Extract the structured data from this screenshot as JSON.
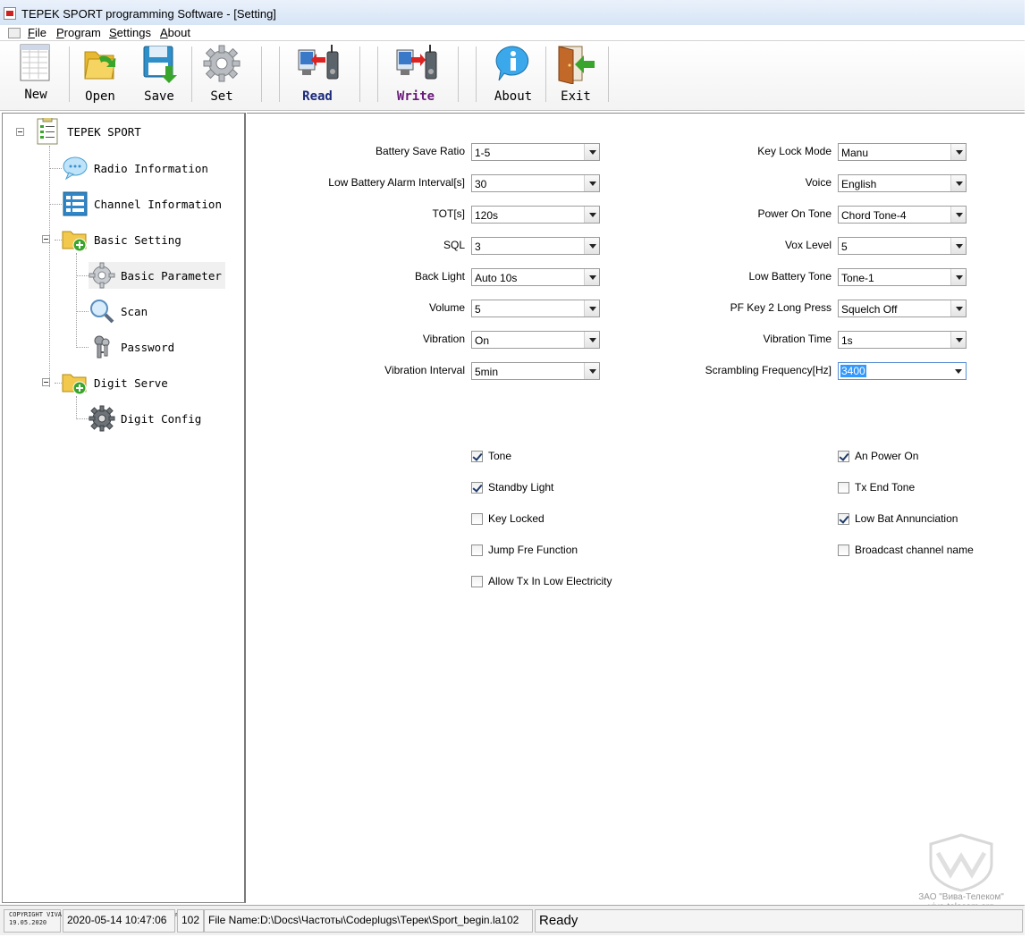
{
  "window": {
    "title": "TEPEK SPORT programming Software - [Setting]"
  },
  "menu": [
    {
      "label": "File",
      "accel": "F"
    },
    {
      "label": "Program",
      "accel": "P"
    },
    {
      "label": "Settings",
      "accel": "S"
    },
    {
      "label": "About",
      "accel": "A"
    }
  ],
  "toolbar": {
    "new": "New",
    "open": "Open",
    "save": "Save",
    "set": "Set",
    "read": "Read",
    "write": "Write",
    "about": "About",
    "exit": "Exit"
  },
  "tree": {
    "root": "TEPEK SPORT",
    "radio_info": "Radio Information",
    "channel_info": "Channel Information",
    "basic_setting": "Basic Setting",
    "basic_parameter": "Basic Parameter",
    "scan": "Scan",
    "password": "Password",
    "digit_serve": "Digit Serve",
    "digit_config": "Digit Config"
  },
  "fields_left": [
    {
      "label": "Battery Save Ratio",
      "value": "1-5"
    },
    {
      "label": "Low Battery Alarm Interval[s]",
      "value": "30"
    },
    {
      "label": "TOT[s]",
      "value": "120s"
    },
    {
      "label": "SQL",
      "value": "3"
    },
    {
      "label": "Back Light",
      "value": "Auto 10s"
    },
    {
      "label": "Volume",
      "value": "5"
    },
    {
      "label": "Vibration",
      "value": "On"
    },
    {
      "label": "Vibration Interval",
      "value": "5min"
    }
  ],
  "fields_right": [
    {
      "label": "Key Lock Mode",
      "value": "Manu"
    },
    {
      "label": "Voice",
      "value": "English"
    },
    {
      "label": "Power On Tone",
      "value": "Chord Tone-4"
    },
    {
      "label": "Vox Level",
      "value": "5"
    },
    {
      "label": "Low Battery Tone",
      "value": "Tone-1"
    },
    {
      "label": "PF Key 2 Long Press",
      "value": "Squelch Off"
    },
    {
      "label": "Vibration Time",
      "value": "1s"
    },
    {
      "label": "Scrambling Frequency[Hz]",
      "value": "3400"
    }
  ],
  "checks_left": [
    {
      "label": "Tone",
      "checked": true
    },
    {
      "label": "Standby Light",
      "checked": true
    },
    {
      "label": "Key Locked",
      "checked": false
    },
    {
      "label": "Jump Fre Function",
      "checked": false
    },
    {
      "label": "Allow Tx In Low Electricity",
      "checked": false
    }
  ],
  "checks_right": [
    {
      "label": "An Power On",
      "checked": true
    },
    {
      "label": "Tx End Tone",
      "checked": false
    },
    {
      "label": "Low Bat Annunciation",
      "checked": true
    },
    {
      "label": "Broadcast channel name",
      "checked": false
    }
  ],
  "watermark": {
    "line1": "ЗАО \"Вива-Телеком\"",
    "line2": "viva-telecom.org"
  },
  "status": {
    "copyright": "COPYRIGHT VIVA-TELECOM, CJSC. Viva-telecom.org. Fullstop",
    "copyright_date": "19.05.2020",
    "datetime": "2020-05-14  10:47:06",
    "code": "102",
    "file": "File Name:D:\\Docs\\Частоты\\Codeplugs\\Терек\\Sport_begin.la102",
    "ready": "Ready"
  },
  "colors": {
    "accent": "#3399ff",
    "titlebar": "#d6e4f6",
    "read_label": "#1a2a7a",
    "write_label": "#6a1a7a"
  }
}
